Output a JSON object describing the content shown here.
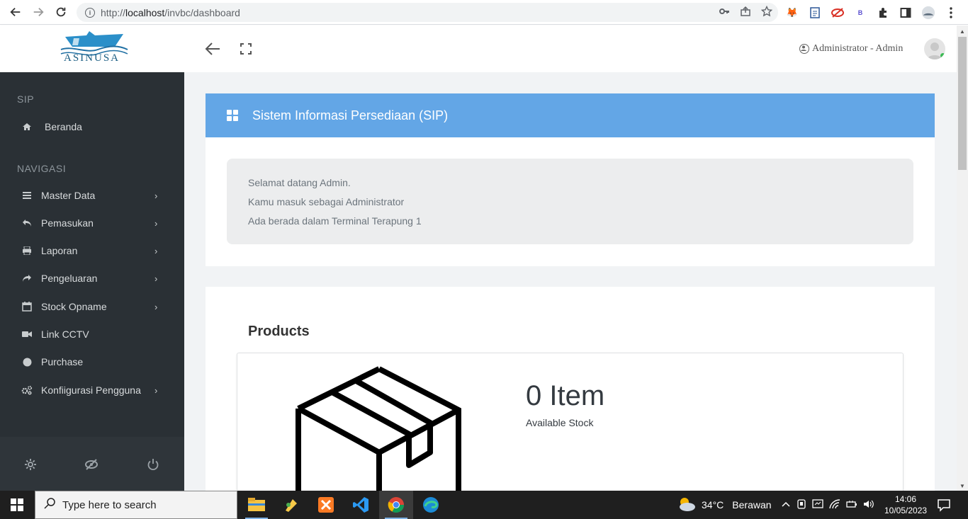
{
  "browser": {
    "url_prefix": "http://",
    "url_host": "localhost",
    "url_path": "/invbc/dashboard"
  },
  "header": {
    "logo_text": "ASINUSA",
    "user_label": "Administrator - Admin"
  },
  "sidebar": {
    "section_sip": "SIP",
    "section_nav": "NAVIGASI",
    "items": [
      {
        "label": "Beranda",
        "icon": "home-icon"
      },
      {
        "label": "Master Data",
        "icon": "list-icon"
      },
      {
        "label": "Pemasukan",
        "icon": "reply-icon"
      },
      {
        "label": "Laporan",
        "icon": "print-icon"
      },
      {
        "label": "Pengeluaran",
        "icon": "share-icon"
      },
      {
        "label": "Stock Opname",
        "icon": "calendar-icon"
      },
      {
        "label": "Link CCTV",
        "icon": "video-icon"
      },
      {
        "label": "Purchase",
        "icon": "circle-icon"
      },
      {
        "label": "Konfiigurasi Pengguna",
        "icon": "cogs-icon"
      }
    ]
  },
  "main": {
    "title": "Sistem Informasi Persediaan (SIP)",
    "welcome_lines": [
      "Selamat datang Admin.",
      "Kamu masuk sebagai Administrator",
      "Ada berada dalam Terminal Terapung 1"
    ],
    "products_title": "Products",
    "stock_count": "0 Item",
    "stock_label": "Available Stock"
  },
  "taskbar": {
    "search_placeholder": "Type here to search",
    "weather_temp": "34°C",
    "weather_desc": "Berawan",
    "time": "14:06",
    "date": "10/05/2023"
  },
  "colors": {
    "sidebar_bg": "#2a3035",
    "title_bar": "#63a6e6",
    "main_bg": "#f1f3f5"
  }
}
